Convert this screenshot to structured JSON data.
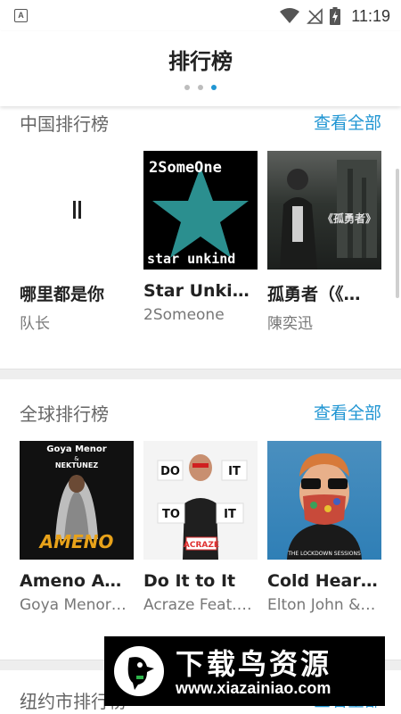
{
  "status_bar": {
    "time": "11:19",
    "left_icon_letter": "A",
    "icons": [
      "wifi-icon",
      "signal-icon",
      "battery-charging-icon"
    ]
  },
  "header": {
    "title": "排行榜",
    "page_indicator": {
      "count": 3,
      "active_index": 2
    }
  },
  "sections": [
    {
      "title": "中国排行榜",
      "view_all": "查看全部",
      "items": [
        {
          "title": "哪里都是你",
          "artist": "队长",
          "cover": "loading"
        },
        {
          "title": "Star Unkin…",
          "artist": "2Someone",
          "cover_text_top": "2SomeOne",
          "cover_text_bottom": "star unkind"
        },
        {
          "title": "孤勇者（《…",
          "artist": "陳奕迅",
          "cover_text": "《孤勇者》"
        }
      ]
    },
    {
      "title": "全球排行榜",
      "view_all": "查看全部",
      "items": [
        {
          "title": "Ameno Ame…",
          "artist": "Goya Menor…",
          "cover_text_top": "Goya Menor",
          "cover_text_amp": "&",
          "cover_text_mid": "NEKTUNEZ",
          "cover_text_bottom": "AMENO"
        },
        {
          "title": "Do It to It",
          "artist": "Acraze Feat.…",
          "cover_words": [
            "DO",
            "IT",
            "TO",
            "IT"
          ],
          "cover_text_bottom": "ACRAZE"
        },
        {
          "title": "Cold Heart…",
          "artist": "Elton John &…",
          "cover_text_bottom": "THE LOCKDOWN SESSIONS"
        }
      ]
    },
    {
      "title": "纽约市排行榜",
      "view_all": "查看全部"
    }
  ],
  "watermark": {
    "name": "下载鸟资源",
    "url": "www.xiazainiao.com"
  },
  "colors": {
    "accent": "#2196d3",
    "divider": "#eeeeee",
    "star_bg": "#2b8f8f"
  }
}
